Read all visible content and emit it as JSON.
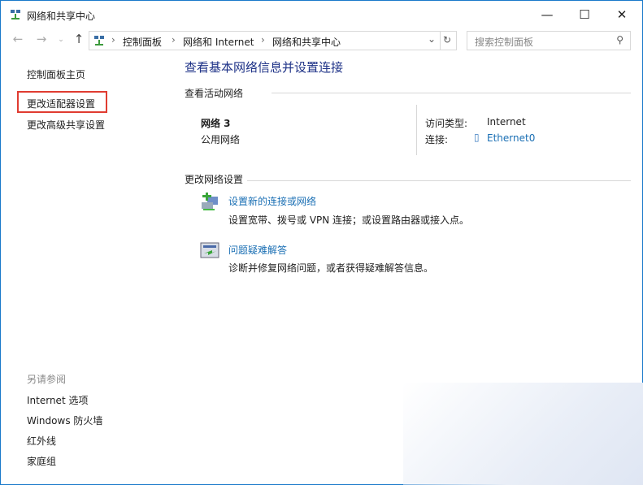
{
  "window": {
    "title": "网络和共享中心"
  },
  "address": {
    "crumbs": [
      "控制面板",
      "网络和 Internet",
      "网络和共享中心"
    ]
  },
  "search": {
    "placeholder": "搜索控制面板"
  },
  "sidebar": {
    "items": [
      "控制面板主页",
      "更改适配器设置",
      "更改高级共享设置"
    ],
    "see_also_title": "另请参阅",
    "see_also": [
      "Internet 选项",
      "Windows 防火墙",
      "红外线",
      "家庭组"
    ]
  },
  "main": {
    "title": "查看基本网络信息并设置连接",
    "active_title": "查看活动网络",
    "network_name": "网络  3",
    "network_type": "公用网络",
    "access_label": "访问类型:",
    "access_value": "Internet",
    "conn_label": "连接:",
    "conn_value": "Ethernet0",
    "change_title": "更改网络设置",
    "tasks": [
      {
        "title": "设置新的连接或网络",
        "desc": "设置宽带、拨号或 VPN 连接；或设置路由器或接入点。"
      },
      {
        "title": "问题疑难解答",
        "desc": "诊断并修复网络问题，或者获得疑难解答信息。"
      }
    ]
  }
}
